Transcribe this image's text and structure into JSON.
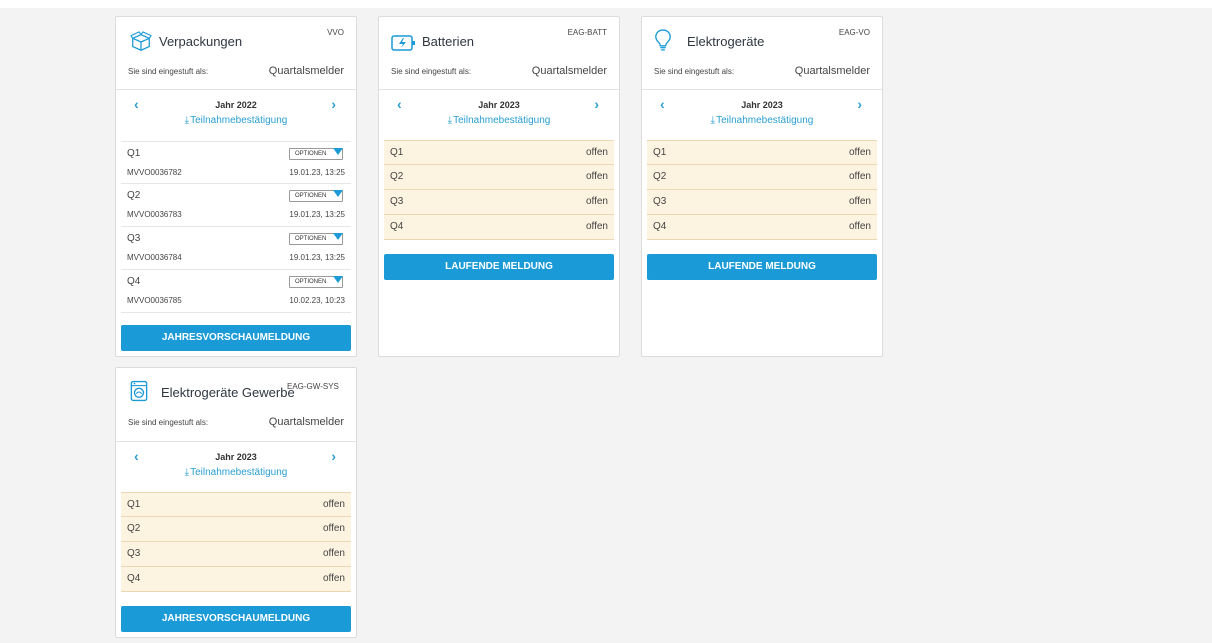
{
  "cards": [
    {
      "title": "Verpackungen",
      "code": "VVO",
      "icon": "package-icon",
      "classified_label": "Sie sind eingestuft als:",
      "classified_value": "Quartalsmelder",
      "year": "Jahr 2022",
      "participation": "Teilnahmebestätigung",
      "submissions": [
        {
          "quarter": "Q1",
          "id": "MVVO0036782",
          "date": "19.01.23, 13:25",
          "options": "OPTIONEN"
        },
        {
          "quarter": "Q2",
          "id": "MVVO0036783",
          "date": "19.01.23, 13:25",
          "options": "OPTIONEN"
        },
        {
          "quarter": "Q3",
          "id": "MVVO0036784",
          "date": "19.01.23, 13:25",
          "options": "OPTIONEN"
        },
        {
          "quarter": "Q4",
          "id": "MVVO0036785",
          "date": "10.02.23, 10:23",
          "options": "OPTIONEN"
        }
      ],
      "button": "JAHRESVORSCHAUMELDUNG"
    },
    {
      "title": "Batterien",
      "code": "EAG-BATT",
      "icon": "battery-icon",
      "classified_label": "Sie sind eingestuft als:",
      "classified_value": "Quartalsmelder",
      "year": "Jahr 2023",
      "participation": "Teilnahmebestätigung",
      "quarters": [
        {
          "name": "Q1",
          "status": "offen"
        },
        {
          "name": "Q2",
          "status": "offen"
        },
        {
          "name": "Q3",
          "status": "offen"
        },
        {
          "name": "Q4",
          "status": "offen"
        }
      ],
      "button": "LAUFENDE MELDUNG"
    },
    {
      "title": "Elektrogeräte",
      "code": "EAG-VO",
      "icon": "lightbulb-icon",
      "classified_label": "Sie sind eingestuft als:",
      "classified_value": "Quartalsmelder",
      "year": "Jahr 2023",
      "participation": "Teilnahmebestätigung",
      "quarters": [
        {
          "name": "Q1",
          "status": "offen"
        },
        {
          "name": "Q2",
          "status": "offen"
        },
        {
          "name": "Q3",
          "status": "offen"
        },
        {
          "name": "Q4",
          "status": "offen"
        }
      ],
      "button": "LAUFENDE MELDUNG"
    },
    {
      "title": "Elektrogeräte Gewerbe",
      "code": "EAG-GW-SYS",
      "icon": "washing-machine-icon",
      "classified_label": "Sie sind eingestuft als:",
      "classified_value": "Quartalsmelder",
      "year": "Jahr 2023",
      "participation": "Teilnahmebestätigung",
      "quarters": [
        {
          "name": "Q1",
          "status": "offen"
        },
        {
          "name": "Q2",
          "status": "offen"
        },
        {
          "name": "Q3",
          "status": "offen"
        },
        {
          "name": "Q4",
          "status": "offen"
        }
      ],
      "button": "JAHRESVORSCHAUMELDUNG"
    }
  ],
  "colors": {
    "accent": "#1a9ad6",
    "quarter_row_bg": "#fdf3e1",
    "page_bg": "#f3f3f4"
  }
}
